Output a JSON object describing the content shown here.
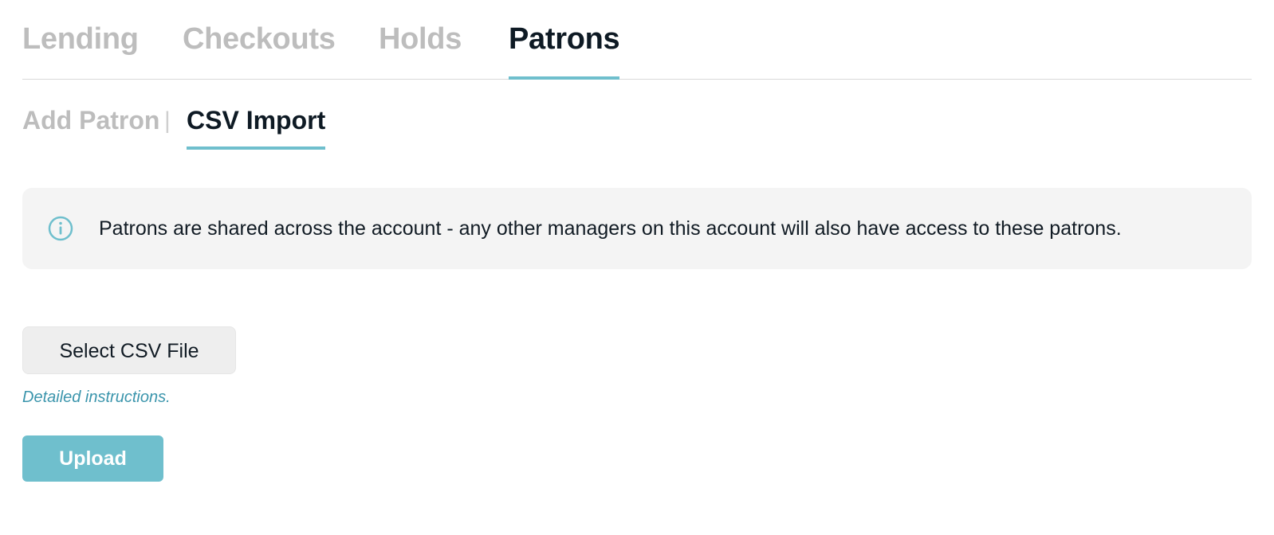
{
  "main_tabs": [
    {
      "label": "Lending",
      "active": false
    },
    {
      "label": "Checkouts",
      "active": false
    },
    {
      "label": "Holds",
      "active": false
    },
    {
      "label": "Patrons",
      "active": true
    }
  ],
  "sub_tabs": {
    "add_patron": "Add Patron",
    "separator": "|",
    "csv_import": "CSV Import",
    "active": "CSV Import"
  },
  "info": {
    "icon": "info-icon",
    "message": "Patrons are shared across the account - any other managers on this account will also have access to these patrons."
  },
  "actions": {
    "select_file_label": "Select CSV File",
    "instructions_label": "Detailed instructions.",
    "upload_label": "Upload"
  },
  "colors": {
    "accent": "#6fbfcd",
    "link": "#3b95ac",
    "inactive_tab": "#bdbdbd",
    "active_tab": "#0e1a24",
    "info_background": "#f4f4f4"
  }
}
